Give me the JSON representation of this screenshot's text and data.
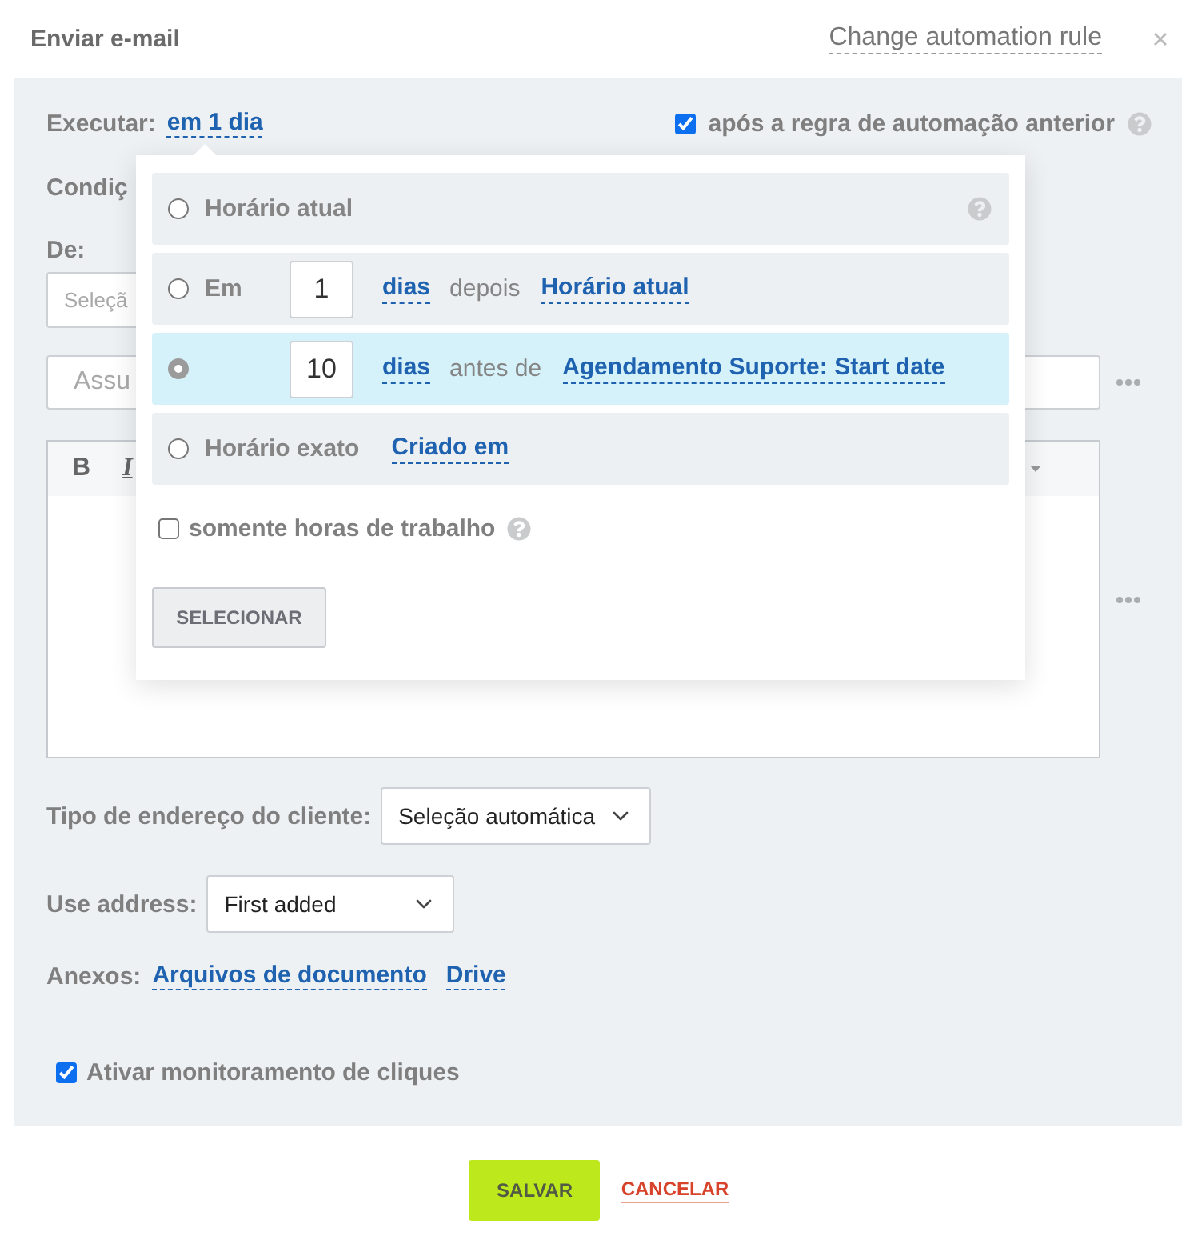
{
  "header": {
    "title": "Enviar e-mail",
    "change_rule_link": "Change automation rule"
  },
  "form": {
    "execute": {
      "label": "Executar:",
      "value": "em 1 dia"
    },
    "after_previous": {
      "checked": true,
      "label": "após a regra de automação anterior"
    },
    "conditions_label": "Condiç",
    "from": {
      "label": "De:",
      "placeholder": "Seleçã"
    },
    "subject": {
      "placeholder": "Assu"
    },
    "editor": {
      "toolbar": [
        {
          "kind": "bold",
          "label": "B"
        },
        {
          "kind": "italic",
          "label": "I"
        }
      ]
    },
    "address_type": {
      "label": "Tipo de endereço do cliente:",
      "value": "Seleção automática"
    },
    "use_address": {
      "label": "Use address:",
      "value": "First added"
    },
    "attachments": {
      "label": "Anexos:",
      "links": [
        "Arquivos de documento",
        "Drive"
      ]
    },
    "click_tracking": {
      "checked": true,
      "label": "Ativar monitoramento de cliques"
    }
  },
  "timing_popup": {
    "options": [
      {
        "kind": "current",
        "selected": false,
        "label": "Horário atual"
      },
      {
        "kind": "offset",
        "selected": false,
        "label": "Em",
        "amount": "1",
        "unit": "dias",
        "relation": "depois",
        "reference": "Horário atual"
      },
      {
        "kind": "offset",
        "selected": true,
        "amount": "10",
        "unit": "dias",
        "relation": "antes de",
        "reference": "Agendamento Suporte: Start date"
      },
      {
        "kind": "exact",
        "selected": false,
        "label": "Horário exato",
        "reference": "Criado em"
      }
    ],
    "working_hours": {
      "checked": false,
      "label": "somente horas de trabalho"
    },
    "select_button": "SELECIONAR"
  },
  "footer": {
    "save": "SALVAR",
    "cancel": "CANCELAR"
  }
}
